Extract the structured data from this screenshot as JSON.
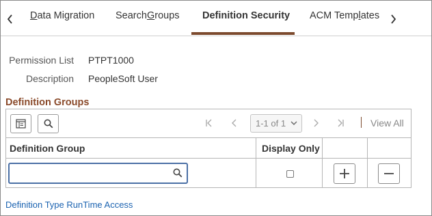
{
  "tabs": {
    "items": [
      {
        "pre": "",
        "u": "D",
        "post": "ata Migration"
      },
      {
        "pre": "Search ",
        "u": "G",
        "post": "roups"
      },
      {
        "pre": "Definition Security",
        "u": "",
        "post": ""
      },
      {
        "pre": "ACM Temp",
        "u": "l",
        "post": "ates"
      }
    ],
    "active_index": 2
  },
  "fields": {
    "permission_list_label": "Permission List",
    "permission_list_value": "PTPT1000",
    "description_label": "Description",
    "description_value": "PeopleSoft User"
  },
  "grid": {
    "title": "Definition Groups",
    "pager_text": "1-1 of 1",
    "view_all": "View All",
    "columns": [
      "Definition Group",
      "Display Only"
    ],
    "rows": [
      {
        "definition_group": "",
        "display_only": false
      }
    ]
  },
  "footer": {
    "link": "Definition Type RunTime Access"
  },
  "colors": {
    "accent": "#7c4a2d",
    "section_title": "#8a4a2a",
    "link": "#1a62b0",
    "input_border": "#4a6fa5"
  }
}
